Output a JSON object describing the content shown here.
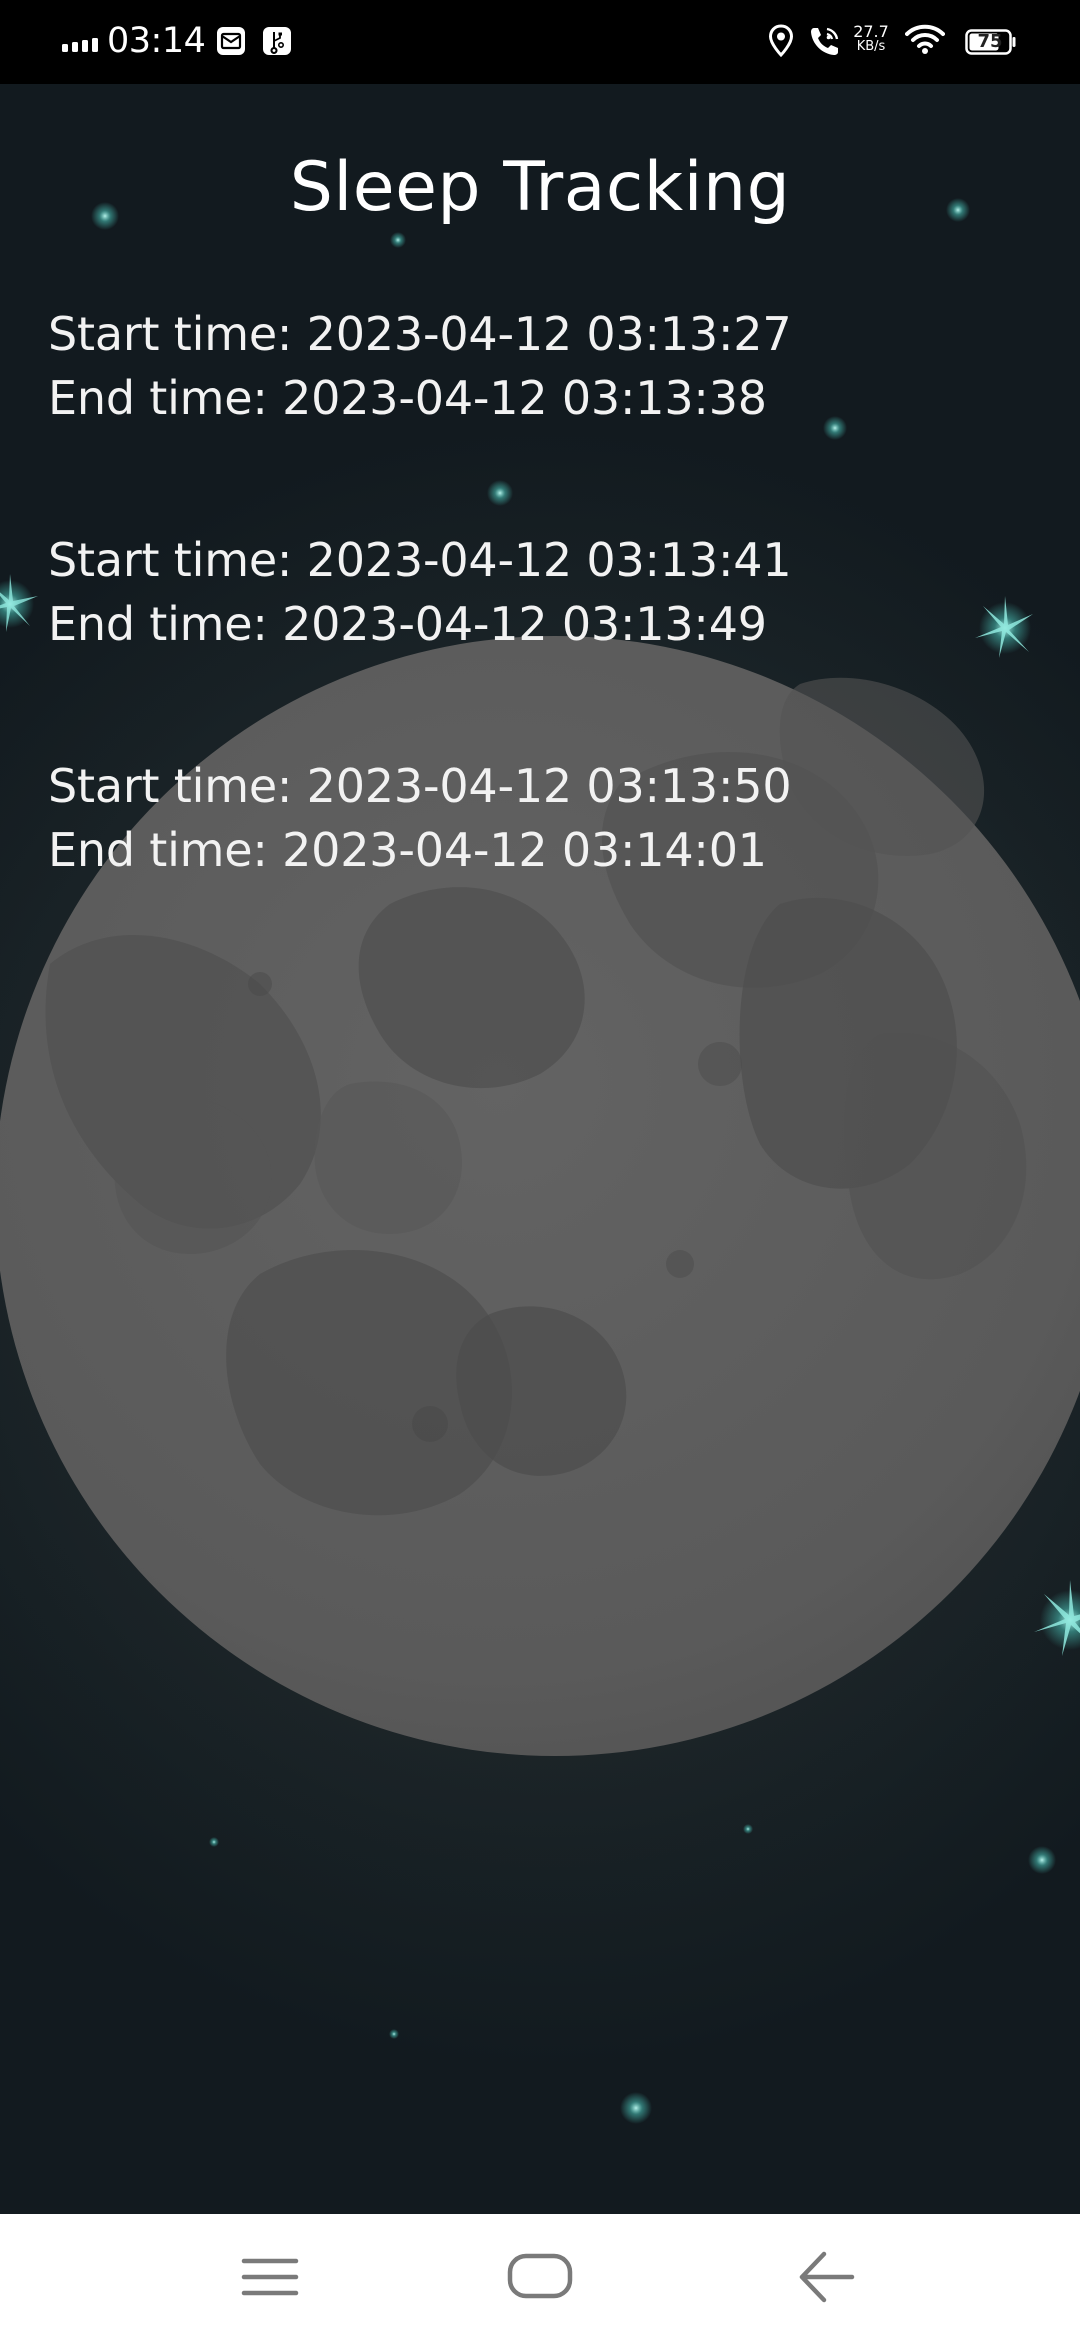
{
  "status_bar": {
    "time": "03:14",
    "signal_icon": "signal-bars-icon",
    "notification_icons": [
      "mail-icon",
      "usb-icon"
    ],
    "right_icons": [
      "location-icon",
      "wifi-calling-icon",
      "wifi-icon"
    ],
    "network_speed_value": "27.7",
    "network_speed_unit": "KB/s",
    "battery_level": "75"
  },
  "app": {
    "title": "Sleep Tracking",
    "colors": {
      "background": "#1b2428",
      "moon": "#5c5c5c",
      "moon_shade": "#4f4f4f",
      "text": "#f2f2f2",
      "star": "#4fd1c5"
    },
    "entries": [
      {
        "start_label": "Start time:",
        "start_value": "2023-04-12 03:13:27",
        "end_label": "End time:",
        "end_value": "2023-04-12 03:13:38"
      },
      {
        "start_label": "Start time:",
        "start_value": "2023-04-12 03:13:41",
        "end_label": "End time:",
        "end_value": "2023-04-12 03:13:49"
      },
      {
        "start_label": "Start time:",
        "start_value": "2023-04-12 03:13:50",
        "end_label": "End time:",
        "end_value": "2023-04-12 03:14:01"
      }
    ]
  },
  "nav_bar": {
    "buttons": [
      "menu-icon",
      "home-icon",
      "back-icon"
    ]
  }
}
